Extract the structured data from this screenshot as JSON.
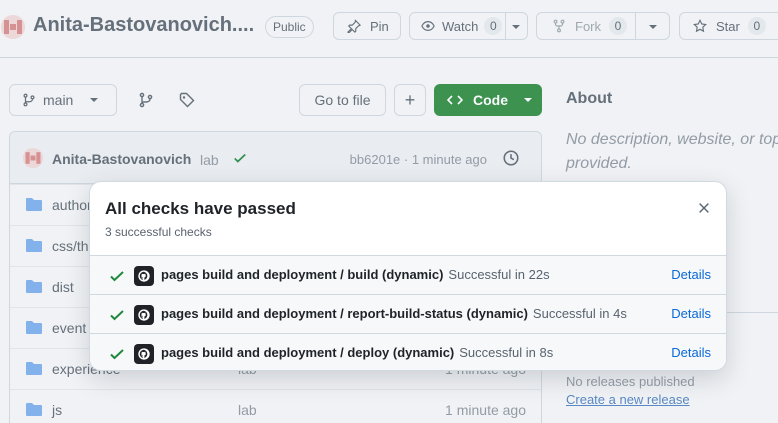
{
  "repo": {
    "name": "Anita-Bastovanovich....",
    "visibility": "Public"
  },
  "actions": {
    "pin_label": "Pin",
    "watch_label": "Watch",
    "watch_count": "0",
    "fork_label": "Fork",
    "fork_count": "0",
    "star_label": "Star",
    "star_count": "0"
  },
  "toolbar": {
    "branch": "main",
    "go_to_file": "Go to file",
    "code_label": "Code"
  },
  "about": {
    "title": "About",
    "description": "No description, website, or topics provided."
  },
  "commit": {
    "author": "Anita-Bastovanovich",
    "message": "lab",
    "hash_time": "bb6201e · 1 minute ago"
  },
  "files": [
    {
      "name": "author",
      "message": "",
      "date": ""
    },
    {
      "name": "css/th",
      "message": "",
      "date": ""
    },
    {
      "name": "dist",
      "message": "",
      "date": ""
    },
    {
      "name": "event",
      "message": "",
      "date": ""
    },
    {
      "name": "experience",
      "message": "lab",
      "date": "1 minute ago"
    },
    {
      "name": "js",
      "message": "lab",
      "date": "1 minute ago"
    }
  ],
  "releases": {
    "none": "No releases published",
    "create": "Create a new release"
  },
  "checks_popover": {
    "title": "All checks have passed",
    "subtitle": "3 successful checks",
    "checks": [
      {
        "name": "pages build and deployment / build (dynamic)",
        "status": "Successful in 22s",
        "action": "Details"
      },
      {
        "name": "pages build and deployment / report-build-status (dynamic)",
        "status": "Successful in 4s",
        "action": "Details"
      },
      {
        "name": "pages build and deployment / deploy (dynamic)",
        "status": "Successful in 8s",
        "action": "Details"
      }
    ]
  },
  "colors": {
    "success_green": "#1f883d",
    "code_button": "#2b8a3e",
    "link_blue": "#0969da"
  }
}
